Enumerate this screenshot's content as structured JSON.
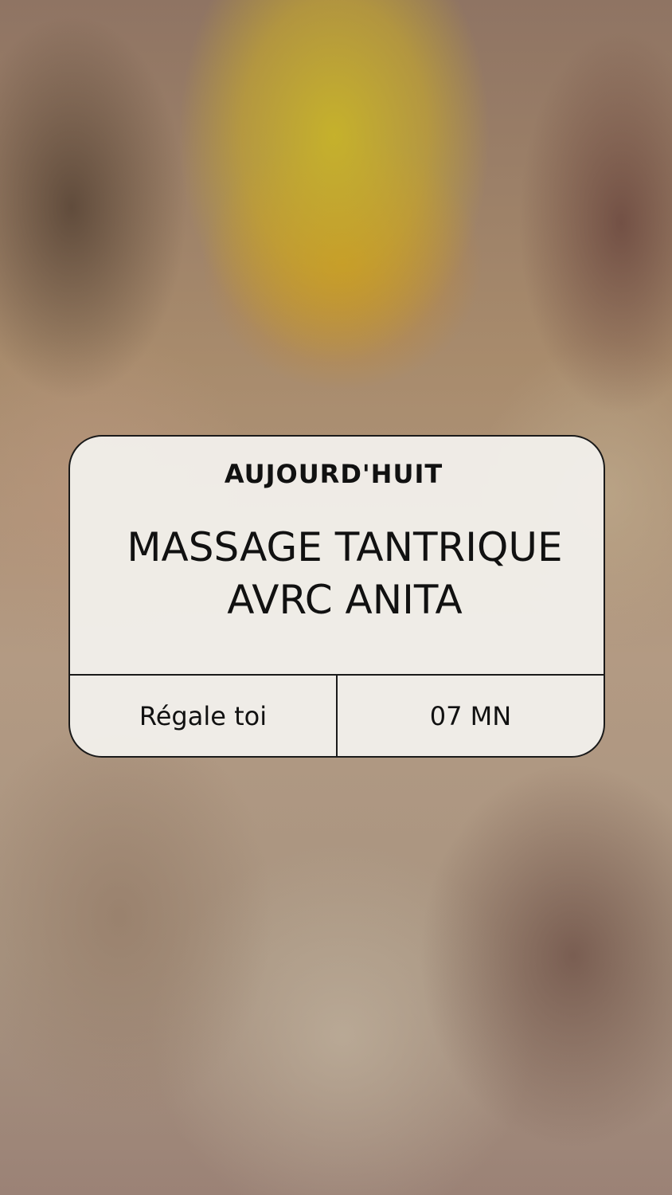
{
  "card": {
    "label": "AUJOURD'HUIT",
    "title_line1": "MASSAGE TANTRIQUE",
    "title_line2": "AVRC ANITA",
    "footer_left": "Régale toi",
    "footer_right": "07 MN"
  },
  "colors": {
    "card_background": "#f2f0ec",
    "card_border": "#1a1a1a",
    "text": "#111111"
  }
}
